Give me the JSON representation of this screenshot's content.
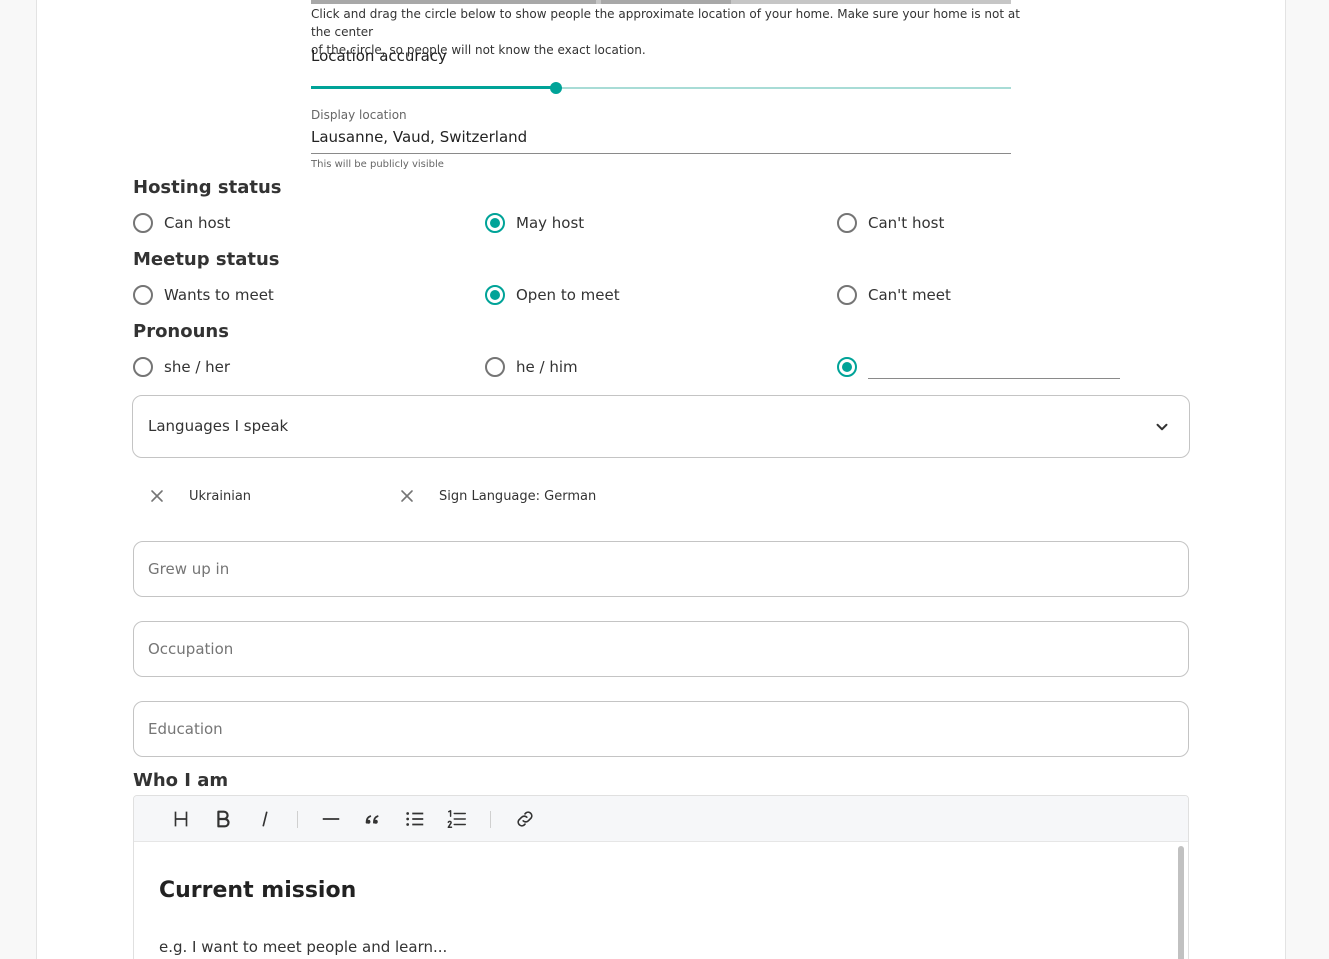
{
  "location": {
    "helper_text_line1": "Click and drag the circle below to show people the approximate location of your home. Make sure your home is not at the center",
    "helper_text_line2": "of the circle, so people will not know the exact location.",
    "accuracy_label": "Location accuracy",
    "accuracy_level_fraction": 0.35,
    "display_label": "Display location",
    "display_value": "Lausanne, Vaud, Switzerland",
    "display_hint": "This will be publicly visible"
  },
  "hosting": {
    "title": "Hosting status",
    "options": [
      "Can host",
      "May host",
      "Can't host"
    ],
    "selected": "May host"
  },
  "meetup": {
    "title": "Meetup status",
    "options": [
      "Wants to meet",
      "Open to meet",
      "Can't meet"
    ],
    "selected": "Open to meet"
  },
  "pronouns": {
    "title": "Pronouns",
    "options": [
      "she / her",
      "he / him"
    ],
    "custom_value": "",
    "selected": "custom"
  },
  "languages": {
    "label": "Languages I speak",
    "chips": [
      "Ukrainian",
      "Sign Language: German"
    ]
  },
  "fields": {
    "grew_up_in": "Grew up in",
    "occupation": "Occupation",
    "education": "Education"
  },
  "who_i_am": {
    "title": "Who I am",
    "heading": "Current mission",
    "placeholder": "e.g. I want to meet people and learn..."
  },
  "colors": {
    "accent": "#00a398",
    "accent_light": "#a8dcd6"
  },
  "icons": {
    "toolbar": [
      "heading-icon",
      "bold-icon",
      "italic-icon",
      "horizontal-rule-icon",
      "quote-icon",
      "bullet-list-icon",
      "numbered-list-icon",
      "link-icon"
    ],
    "chip_remove": "close-icon",
    "select": "chevron-down-icon"
  }
}
